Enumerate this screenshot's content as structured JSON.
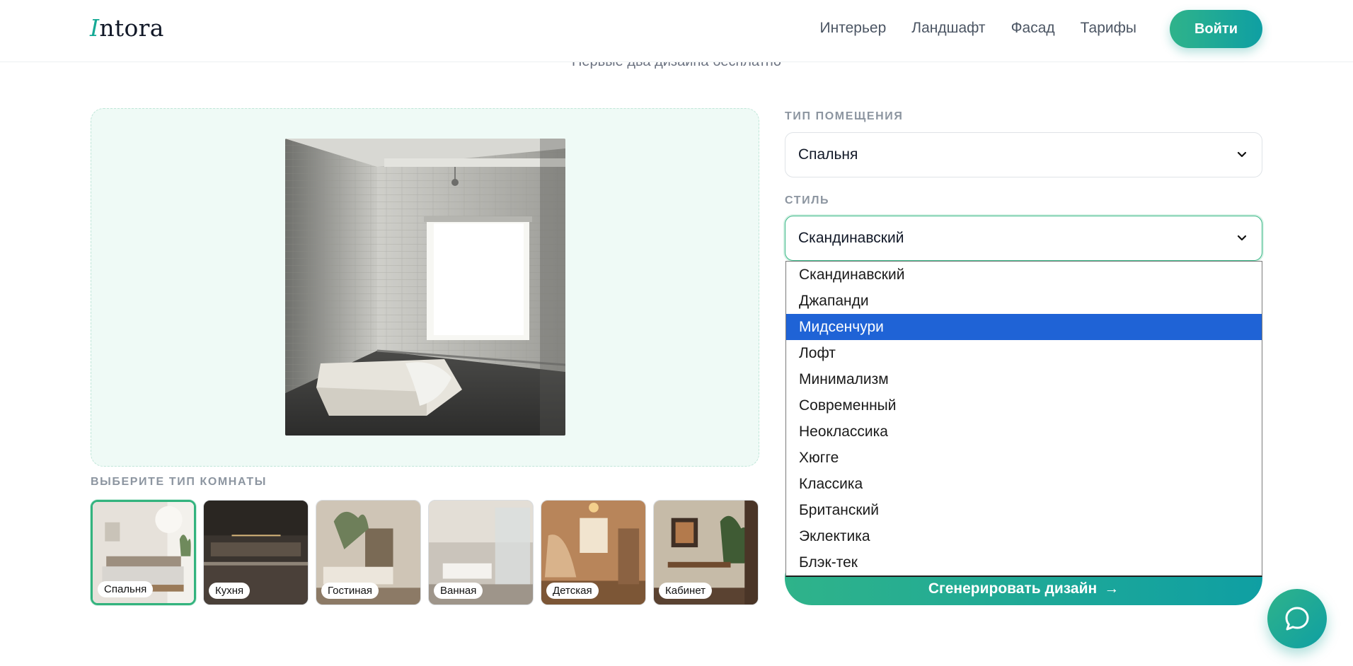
{
  "header": {
    "logo_accent": "I",
    "logo_rest": "ntora",
    "nav": [
      "Интерьер",
      "Ландшафт",
      "Фасад",
      "Тарифы"
    ],
    "login_label": "Войти"
  },
  "subtitle": "Первые два дизайна бесплатно",
  "room_section_label": "ВЫБЕРИТЕ ТИП КОМНАТЫ",
  "rooms": [
    "Спальня",
    "Кухня",
    "Гостиная",
    "Ванная",
    "Детская",
    "Кабинет"
  ],
  "room_type": {
    "label": "ТИП ПОМЕЩЕНИЯ",
    "value": "Спальня"
  },
  "style": {
    "label": "СТИЛЬ",
    "value": "Скандинавский",
    "options": [
      "Скандинавский",
      "Джапанди",
      "Мидсенчури",
      "Лофт",
      "Минимализм",
      "Современный",
      "Неоклассика",
      "Хюгге",
      "Классика",
      "Британский",
      "Эклектика",
      "Блэк-тек"
    ],
    "highlighted": "Мидсенчури"
  },
  "generate_label": "Сгенерировать дизайн",
  "generate_arrow": "→",
  "colors": {
    "accent": "#15a995",
    "highlight": "#1f63d6"
  }
}
